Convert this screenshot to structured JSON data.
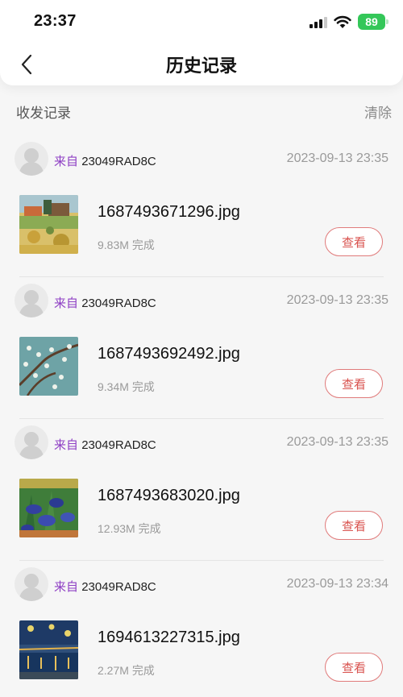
{
  "status_bar": {
    "time": "23:37",
    "battery": "89"
  },
  "header": {
    "title": "历史记录",
    "back_icon": "chevron-left-icon"
  },
  "section": {
    "label": "收发记录",
    "clear": "清除"
  },
  "records": [
    {
      "from_prefix": "来自",
      "device": "23049RAD8C",
      "timestamp": "2023-09-13 23:35",
      "file_name": "1687493671296.jpg",
      "size": "9.83M",
      "status": "完成",
      "view_label": "查看"
    },
    {
      "from_prefix": "来自",
      "device": "23049RAD8C",
      "timestamp": "2023-09-13 23:35",
      "file_name": "1687493692492.jpg",
      "size": "9.34M",
      "status": "完成",
      "view_label": "查看"
    },
    {
      "from_prefix": "来自",
      "device": "23049RAD8C",
      "timestamp": "2023-09-13 23:35",
      "file_name": "1687493683020.jpg",
      "size": "12.93M",
      "status": "完成",
      "view_label": "查看"
    },
    {
      "from_prefix": "来自",
      "device": "23049RAD8C",
      "timestamp": "2023-09-13 23:34",
      "file_name": "1694613227315.jpg",
      "size": "2.27M",
      "status": "完成",
      "view_label": "查看"
    }
  ],
  "colors": {
    "accent_purple": "#8e3fc4",
    "button_red": "#d9534f",
    "battery_green": "#34c759"
  }
}
